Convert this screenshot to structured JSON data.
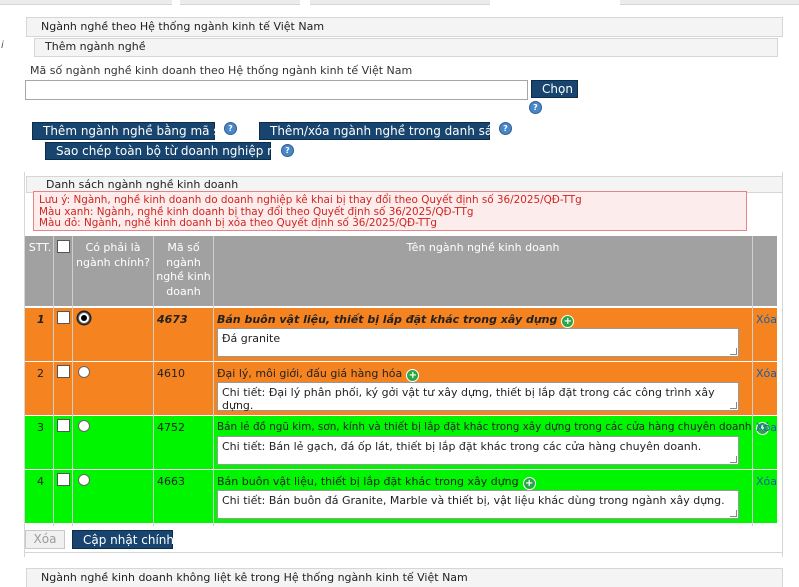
{
  "panel_title": "Ngành nghề theo Hệ thống ngành kinh tế Việt Nam",
  "add_section": {
    "title": "Thêm ngành nghề",
    "field_label": "Mã số ngành nghề kinh doanh theo Hệ thống ngành kinh tế Việt Nam",
    "field_value": "",
    "choose_button": "Chọn",
    "add_by_code_button": "Thêm ngành nghề bằng mã số",
    "add_remove_list_button": "Thêm/xóa ngành nghề trong danh sách",
    "copy_parent_button": "Sao chép toàn bộ từ doanh nghiệp mẹ",
    "help_glyph": "?"
  },
  "list_section": {
    "title": "Danh sách ngành nghề kinh doanh",
    "notes": [
      "Lưu ý: Ngành, nghề kinh doanh do doanh nghiệp kê khai bị thay đổi theo Quyết định số 36/2025/QĐ-TTg",
      "Màu xanh: Ngành, nghề kinh doanh bị thay đổi theo Quyết định số 36/2025/QĐ-TTg",
      "Màu đỏ: Ngành, nghề kinh doanh bị xóa theo Quyết định số 36/2025/QĐ-TTg"
    ],
    "headers": {
      "stt": "STT.",
      "is_main_line1": "Có phải là",
      "is_main_line2": "ngành chính?",
      "code_line1": "Mã số",
      "code_line2": "ngành",
      "code_line3": "nghề kinh",
      "code_line4": "doanh",
      "name": "Tên ngành nghề kinh doanh"
    },
    "rows": [
      {
        "stt": "1",
        "code": "4673",
        "name": "Bán buôn vật liệu, thiết bị lắp đặt khác trong xây dựng",
        "detail": "Đá granite",
        "delete": "Xóa",
        "is_main": true,
        "color": "#f5831f"
      },
      {
        "stt": "2",
        "code": "4610",
        "name": "Đại lý, môi giới, đấu giá hàng hóa",
        "detail": "Chi tiết: Đại lý phân phối, ký gởi vật tư xây dựng, thiết bị lắp đặt trong các công trình xây dựng.",
        "delete": "Xóa",
        "is_main": false,
        "color": "#f5831f"
      },
      {
        "stt": "3",
        "code": "4752",
        "name": "Bán lẻ đồ ngũ kim, sơn, kính và thiết bị lắp đặt khác trong xây dựng trong các cửa hàng chuyên doanh",
        "detail": "Chi tiết: Bán lẻ gạch, đá ốp lát, thiết bị lắp đặt khác trong các cửa hàng chuyên doanh.",
        "delete": "Xóa",
        "is_main": false,
        "color": "#00f500"
      },
      {
        "stt": "4",
        "code": "4663",
        "name": "Bán buôn vật liệu, thiết bị lắp đặt khác trong xây dựng",
        "detail": "Chi tiết: Bán buôn đá Granite, Marble và thiết bị, vật liệu khác dùng trong ngành xây dựng.",
        "delete": "Xóa",
        "is_main": false,
        "color": "#00f500"
      }
    ],
    "delete_button": "Xóa",
    "update_main_button": "Cập nhật chính"
  },
  "bottom_panel_title": "Ngành nghề kinh doanh không liệt kê trong Hệ thống ngành kinh tế Việt Nam",
  "left_marker": "i"
}
